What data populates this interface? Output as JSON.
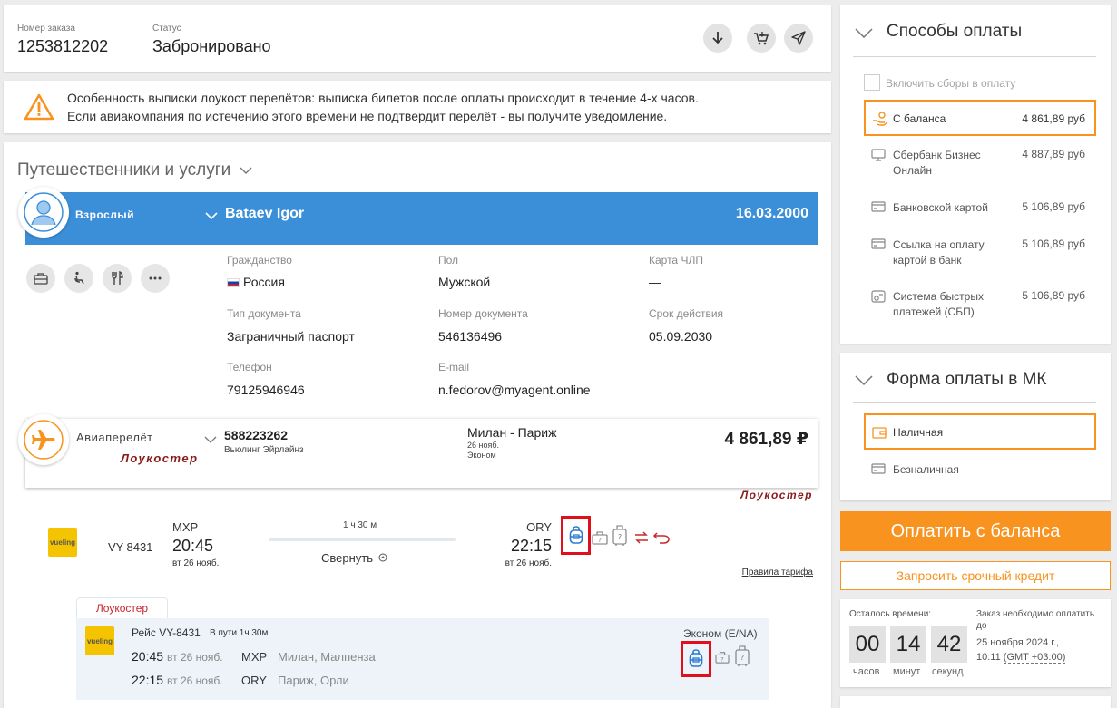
{
  "order": {
    "number_label": "Номер заказа",
    "number": "1253812202",
    "status_label": "Статус",
    "status": "Забронировано"
  },
  "notice": {
    "line1": "Особенность выписки лоукост перелётов: выписка билетов после оплаты происходит в течение 4-х часов.",
    "line2": "Если авиакомпания по истечению этого времени не подтвердит перелёт - вы получите уведомление."
  },
  "travelers": {
    "title": "Путешественники и услуги",
    "passenger": {
      "type": "Взрослый",
      "name": "Bataev Igor",
      "birthdate": "16.03.2000",
      "fields": {
        "citizenship_label": "Гражданство",
        "citizenship": "Россия",
        "gender_label": "Пол",
        "gender": "Мужской",
        "loyalty_label": "Карта ЧЛП",
        "loyalty": "—",
        "doc_type_label": "Тип документа",
        "doc_type": "Заграничный паспорт",
        "doc_number_label": "Номер документа",
        "doc_number": "546136496",
        "expiry_label": "Срок действия",
        "expiry": "05.09.2030",
        "phone_label": "Телефон",
        "phone": "79125946946",
        "email_label": "E-mail",
        "email": "n.fedorov@myagent.online"
      }
    }
  },
  "flight": {
    "type": "Авиаперелёт",
    "lowcost": "Лоукостер",
    "booking_number": "588223262",
    "airline": "Вьюлинг Эйрлайнз",
    "route": "Милан - Париж",
    "date": "26 нояб.",
    "cabin": "Эконом",
    "price": "4 861,89 ₽",
    "lowcost_tag": "Лоукостер",
    "segment": {
      "logo": "vueling",
      "flight_no": "VY-8431",
      "from_code": "MXP",
      "dep_time": "20:45",
      "dep_date": "вт 26 нояб.",
      "duration": "1 ч 30 м",
      "collapse": "Свернуть",
      "to_code": "ORY",
      "arr_time": "22:15",
      "arr_date": "вт 26 нояб.",
      "fare_rules": "Правила тарифа"
    },
    "detail": {
      "tab": "Лоукостер",
      "logo": "vueling",
      "flight_title": "Рейс VY-8431",
      "in_transit": "В пути 1ч.30м",
      "cabin": "Эконом (E/NA)",
      "dep_time": "20:45",
      "dep_date": "вт 26 нояб.",
      "dep_code": "MXP",
      "dep_airport": "Милан, Малпенза",
      "arr_time": "22:15",
      "arr_date": "вт 26 нояб.",
      "arr_code": "ORY",
      "arr_airport": "Париж, Орли"
    }
  },
  "payment": {
    "title": "Способы оплаты",
    "include_fees": "Включить сборы в оплату",
    "methods": [
      {
        "label": "С баланса",
        "amount": "4 861,89 руб"
      },
      {
        "label": "Сбербанк Бизнес Онлайн",
        "amount": "4 887,89 руб"
      },
      {
        "label": "Банковской картой",
        "amount": "5 106,89 руб"
      },
      {
        "label": "Ссылка на оплату картой в банк",
        "amount": "5 106,89 руб"
      },
      {
        "label": "Система быстрых платежей (СБП)",
        "amount": "5 106,89 руб"
      }
    ]
  },
  "mk_payment": {
    "title": "Форма оплаты в МК",
    "options": [
      "Наличная",
      "Безналичная"
    ]
  },
  "actions": {
    "pay": "Оплатить с баланса",
    "credit": "Запросить срочный кредит"
  },
  "timer": {
    "left_label": "Осталось времени:",
    "hours": "00",
    "minutes": "14",
    "seconds": "42",
    "hours_label": "часов",
    "minutes_label": "минут",
    "seconds_label": "секунд",
    "deadline_label": "Заказ необходимо оплатить до",
    "deadline_date": "25 ноября 2024 г.,",
    "deadline_time": "10:11",
    "deadline_tz": "(GMT +03:00)"
  },
  "colors": {
    "accent_orange": "#f7931e",
    "passenger_blue": "#3b8fd9",
    "lowcost_red": "#8b1a1a",
    "highlight_red": "#e0101a"
  }
}
